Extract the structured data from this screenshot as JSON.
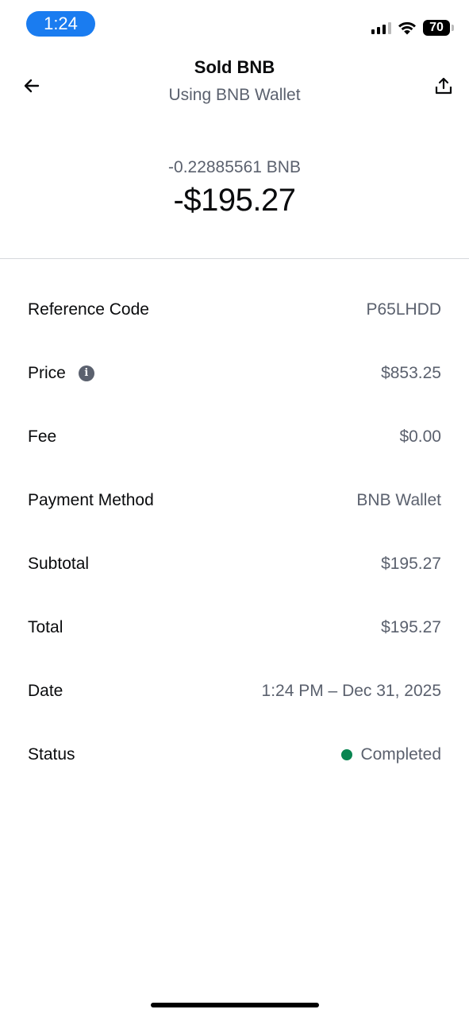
{
  "status_bar": {
    "time": "1:24",
    "battery": "70"
  },
  "header": {
    "title": "Sold BNB",
    "subtitle": "Using BNB Wallet"
  },
  "amount": {
    "crypto": "-0.22885561 BNB",
    "fiat": "-$195.27"
  },
  "details": {
    "reference": {
      "label": "Reference Code",
      "value": "P65LHDD"
    },
    "price": {
      "label": "Price",
      "value": "$853.25"
    },
    "fee": {
      "label": "Fee",
      "value": "$0.00"
    },
    "payment": {
      "label": "Payment Method",
      "value": "BNB Wallet"
    },
    "subtotal": {
      "label": "Subtotal",
      "value": "$195.27"
    },
    "total": {
      "label": "Total",
      "value": "$195.27"
    },
    "date": {
      "label": "Date",
      "value": "1:24 PM – Dec 31, 2025"
    },
    "status": {
      "label": "Status",
      "value": "Completed"
    }
  },
  "icons": {
    "back": "arrow-left-icon",
    "share": "share-icon",
    "info": "info-icon"
  },
  "colors": {
    "time_pill": "#1a7cf0",
    "status_completed": "#098551",
    "secondary_text": "#5b616e"
  }
}
